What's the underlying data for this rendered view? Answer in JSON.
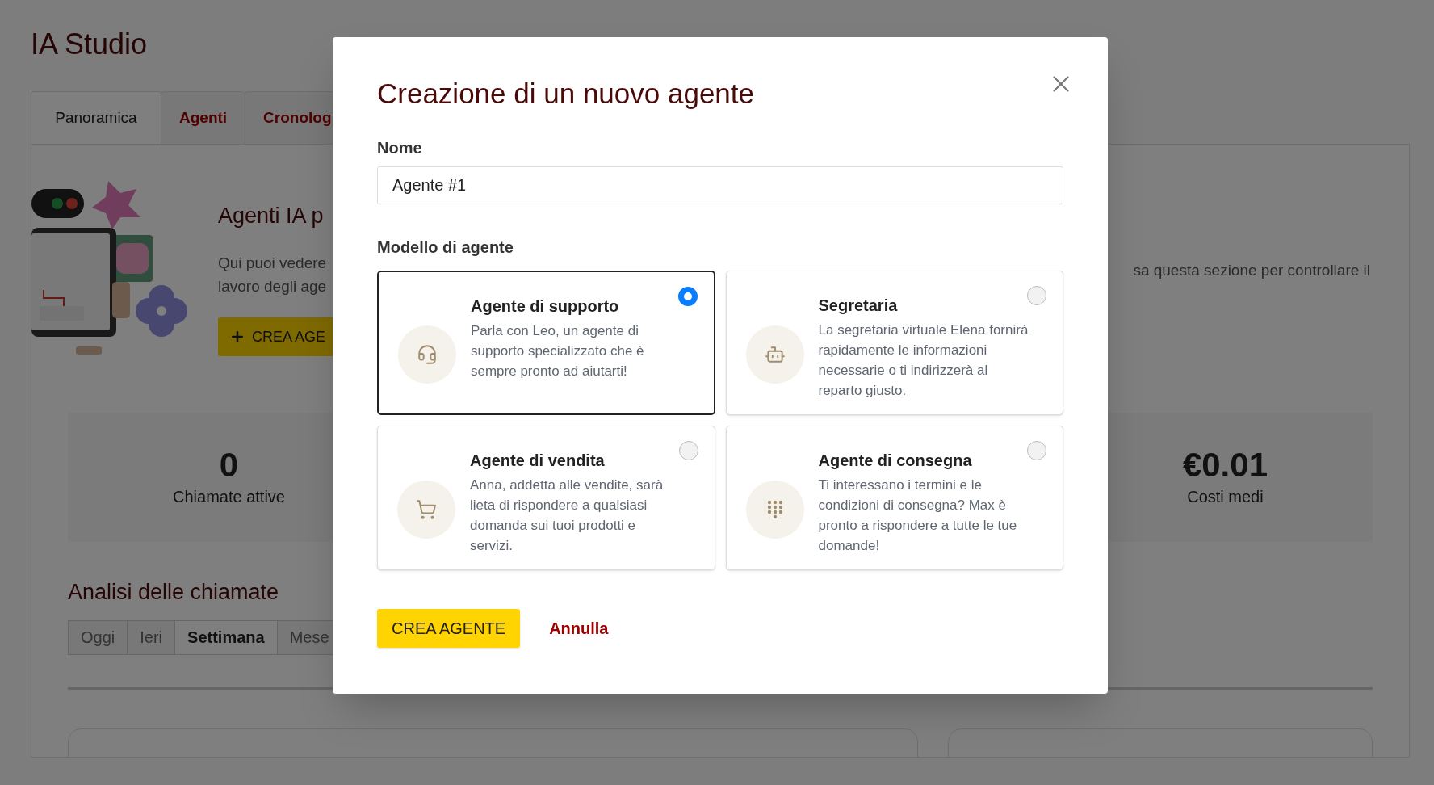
{
  "page": {
    "title": "IA Studio",
    "tabs": [
      {
        "label": "Panoramica",
        "selected": true
      },
      {
        "label": "Agenti",
        "selected": false
      },
      {
        "label": "Cronolog",
        "selected": false
      }
    ],
    "hero": {
      "heading": "Agenti IA p",
      "text_lines": [
        "Qui puoi vedere",
        "lavoro degli age"
      ],
      "button": "CREA AGE",
      "text_right": "sa questa sezione per controllare il"
    },
    "stats": [
      {
        "value": "0",
        "label": "Chiamate attive"
      },
      {
        "value": "€0.01",
        "label": "Costi medi"
      }
    ],
    "analysis": {
      "heading": "Analisi delle chiamate",
      "periods": [
        {
          "label": "Oggi",
          "selected": false
        },
        {
          "label": "Ieri",
          "selected": false
        },
        {
          "label": "Settimana",
          "selected": true
        },
        {
          "label": "Mese",
          "selected": false
        }
      ]
    }
  },
  "modal": {
    "title": "Creazione di un nuovo agente",
    "name_label": "Nome",
    "name_value": "Agente #1",
    "model_label": "Modello di agente",
    "models": [
      {
        "kind": "support",
        "title": "Agente di supporto",
        "description": "Parla con Leo, un agente di supporto specializzato che è sempre pronto ad aiutarti!",
        "selected": true
      },
      {
        "kind": "secretary",
        "title": "Segretaria",
        "description": "La segretaria virtuale Elena fornirà rapidamente le informazioni necessarie o ti indirizzerà al reparto giusto.",
        "selected": false
      },
      {
        "kind": "sales",
        "title": "Agente di vendita",
        "description": "Anna, addetta alle vendite, sarà lieta di rispondere a qualsiasi domanda sui tuoi prodotti e servizi.",
        "selected": false
      },
      {
        "kind": "delivery",
        "title": "Agente di consegna",
        "description": "Ti interessano i termini e le condizioni di consegna? Max è pronto a rispondere a tutte le tue domande!",
        "selected": false
      }
    ],
    "primary_button": "CREA AGENTE",
    "secondary_button": "Annulla"
  }
}
